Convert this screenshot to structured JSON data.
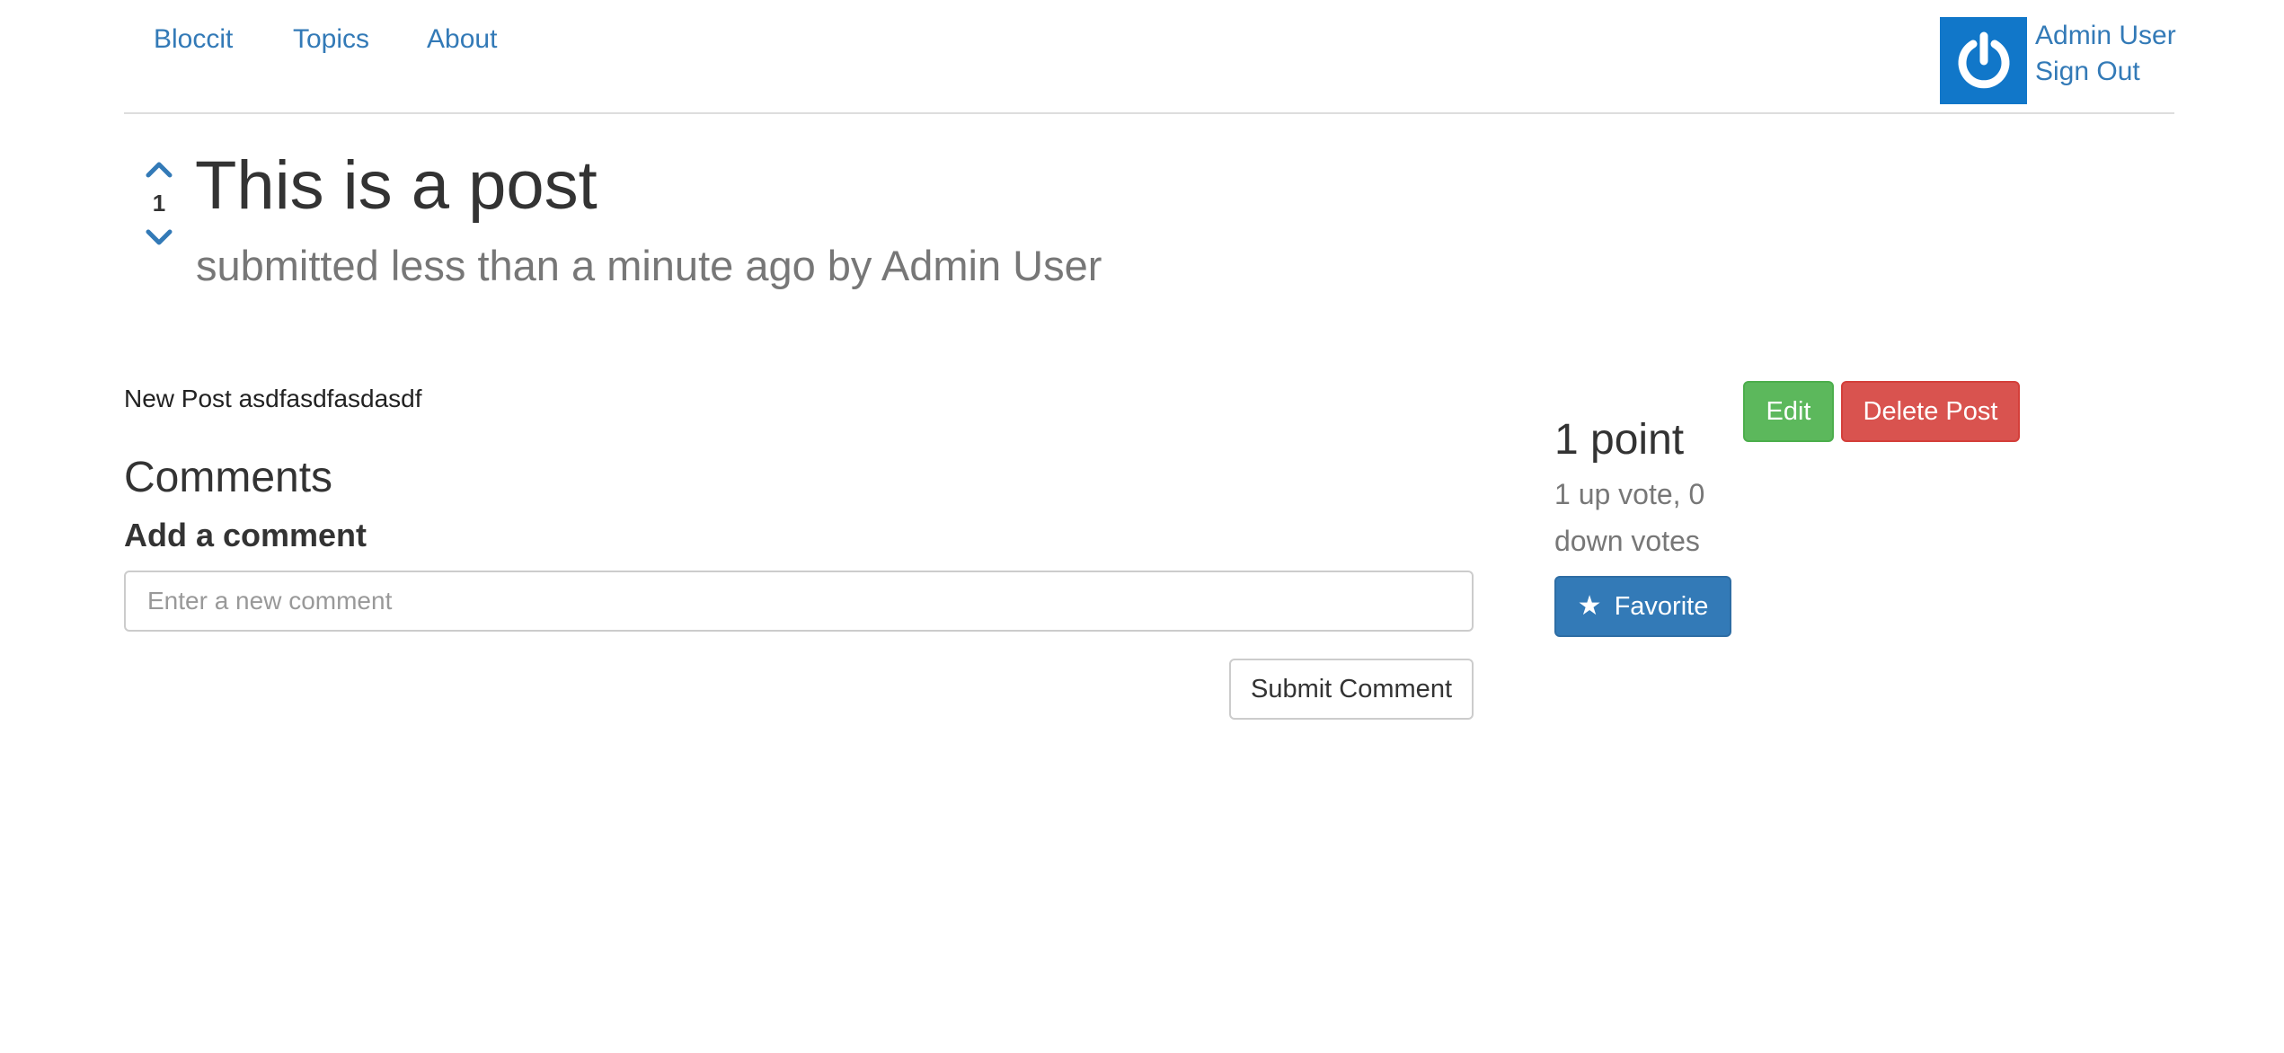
{
  "nav": {
    "brand": "Bloccit",
    "links": [
      "Topics",
      "About"
    ]
  },
  "user": {
    "name": "Admin User",
    "sign_out": "Sign Out",
    "avatar_icon": "power-icon",
    "avatar_color": "#1177c9"
  },
  "post": {
    "vote_count": "1",
    "title": "This is a post",
    "meta": "submitted less than a minute ago by Admin User",
    "body": "New Post asdfasdfasdasdf"
  },
  "comments": {
    "heading": "Comments",
    "add_heading": "Add a comment",
    "placeholder": "Enter a new comment",
    "value": "",
    "submit_label": "Submit Comment"
  },
  "sidebar": {
    "edit_label": "Edit",
    "delete_label": "Delete Post",
    "points": "1 point",
    "vote_line1": "1 up vote, 0",
    "vote_line2": "down votes",
    "favorite_label": "Favorite",
    "favorite_icon": "star-icon"
  },
  "colors": {
    "link": "#337ab7",
    "success": "#5cb85c",
    "danger": "#d9534f",
    "primary": "#337ab7"
  }
}
